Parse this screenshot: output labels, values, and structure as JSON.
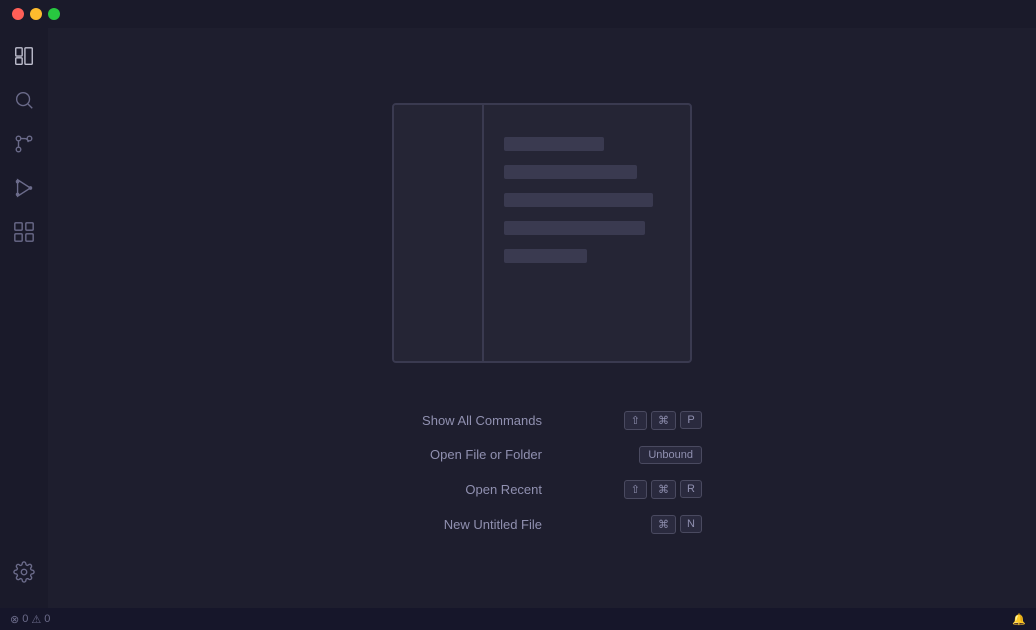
{
  "titlebar": {
    "traffic_lights": [
      "close",
      "minimize",
      "maximize"
    ]
  },
  "activity_bar": {
    "icons": [
      {
        "name": "files-icon",
        "label": "Explorer",
        "active": true
      },
      {
        "name": "search-icon",
        "label": "Search",
        "active": false
      },
      {
        "name": "source-control-icon",
        "label": "Source Control",
        "active": false
      },
      {
        "name": "run-debug-icon",
        "label": "Run and Debug",
        "active": false
      },
      {
        "name": "extensions-icon",
        "label": "Extensions",
        "active": false
      }
    ],
    "bottom_icons": [
      {
        "name": "settings-icon",
        "label": "Settings",
        "active": false
      }
    ]
  },
  "shortcuts": [
    {
      "label": "Show All Commands",
      "keys": [
        "⇧",
        "⌘",
        "P"
      ],
      "type": "keys"
    },
    {
      "label": "Open File or Folder",
      "keys": [
        "Unbound"
      ],
      "type": "unbound"
    },
    {
      "label": "Open Recent",
      "keys": [
        "⇧",
        "⌘",
        "R"
      ],
      "type": "keys"
    },
    {
      "label": "New Untitled File",
      "keys": [
        "⌘",
        "N"
      ],
      "type": "keys"
    }
  ],
  "statusbar": {
    "errors": "0",
    "warnings": "0",
    "bell_icon": "🔔"
  }
}
